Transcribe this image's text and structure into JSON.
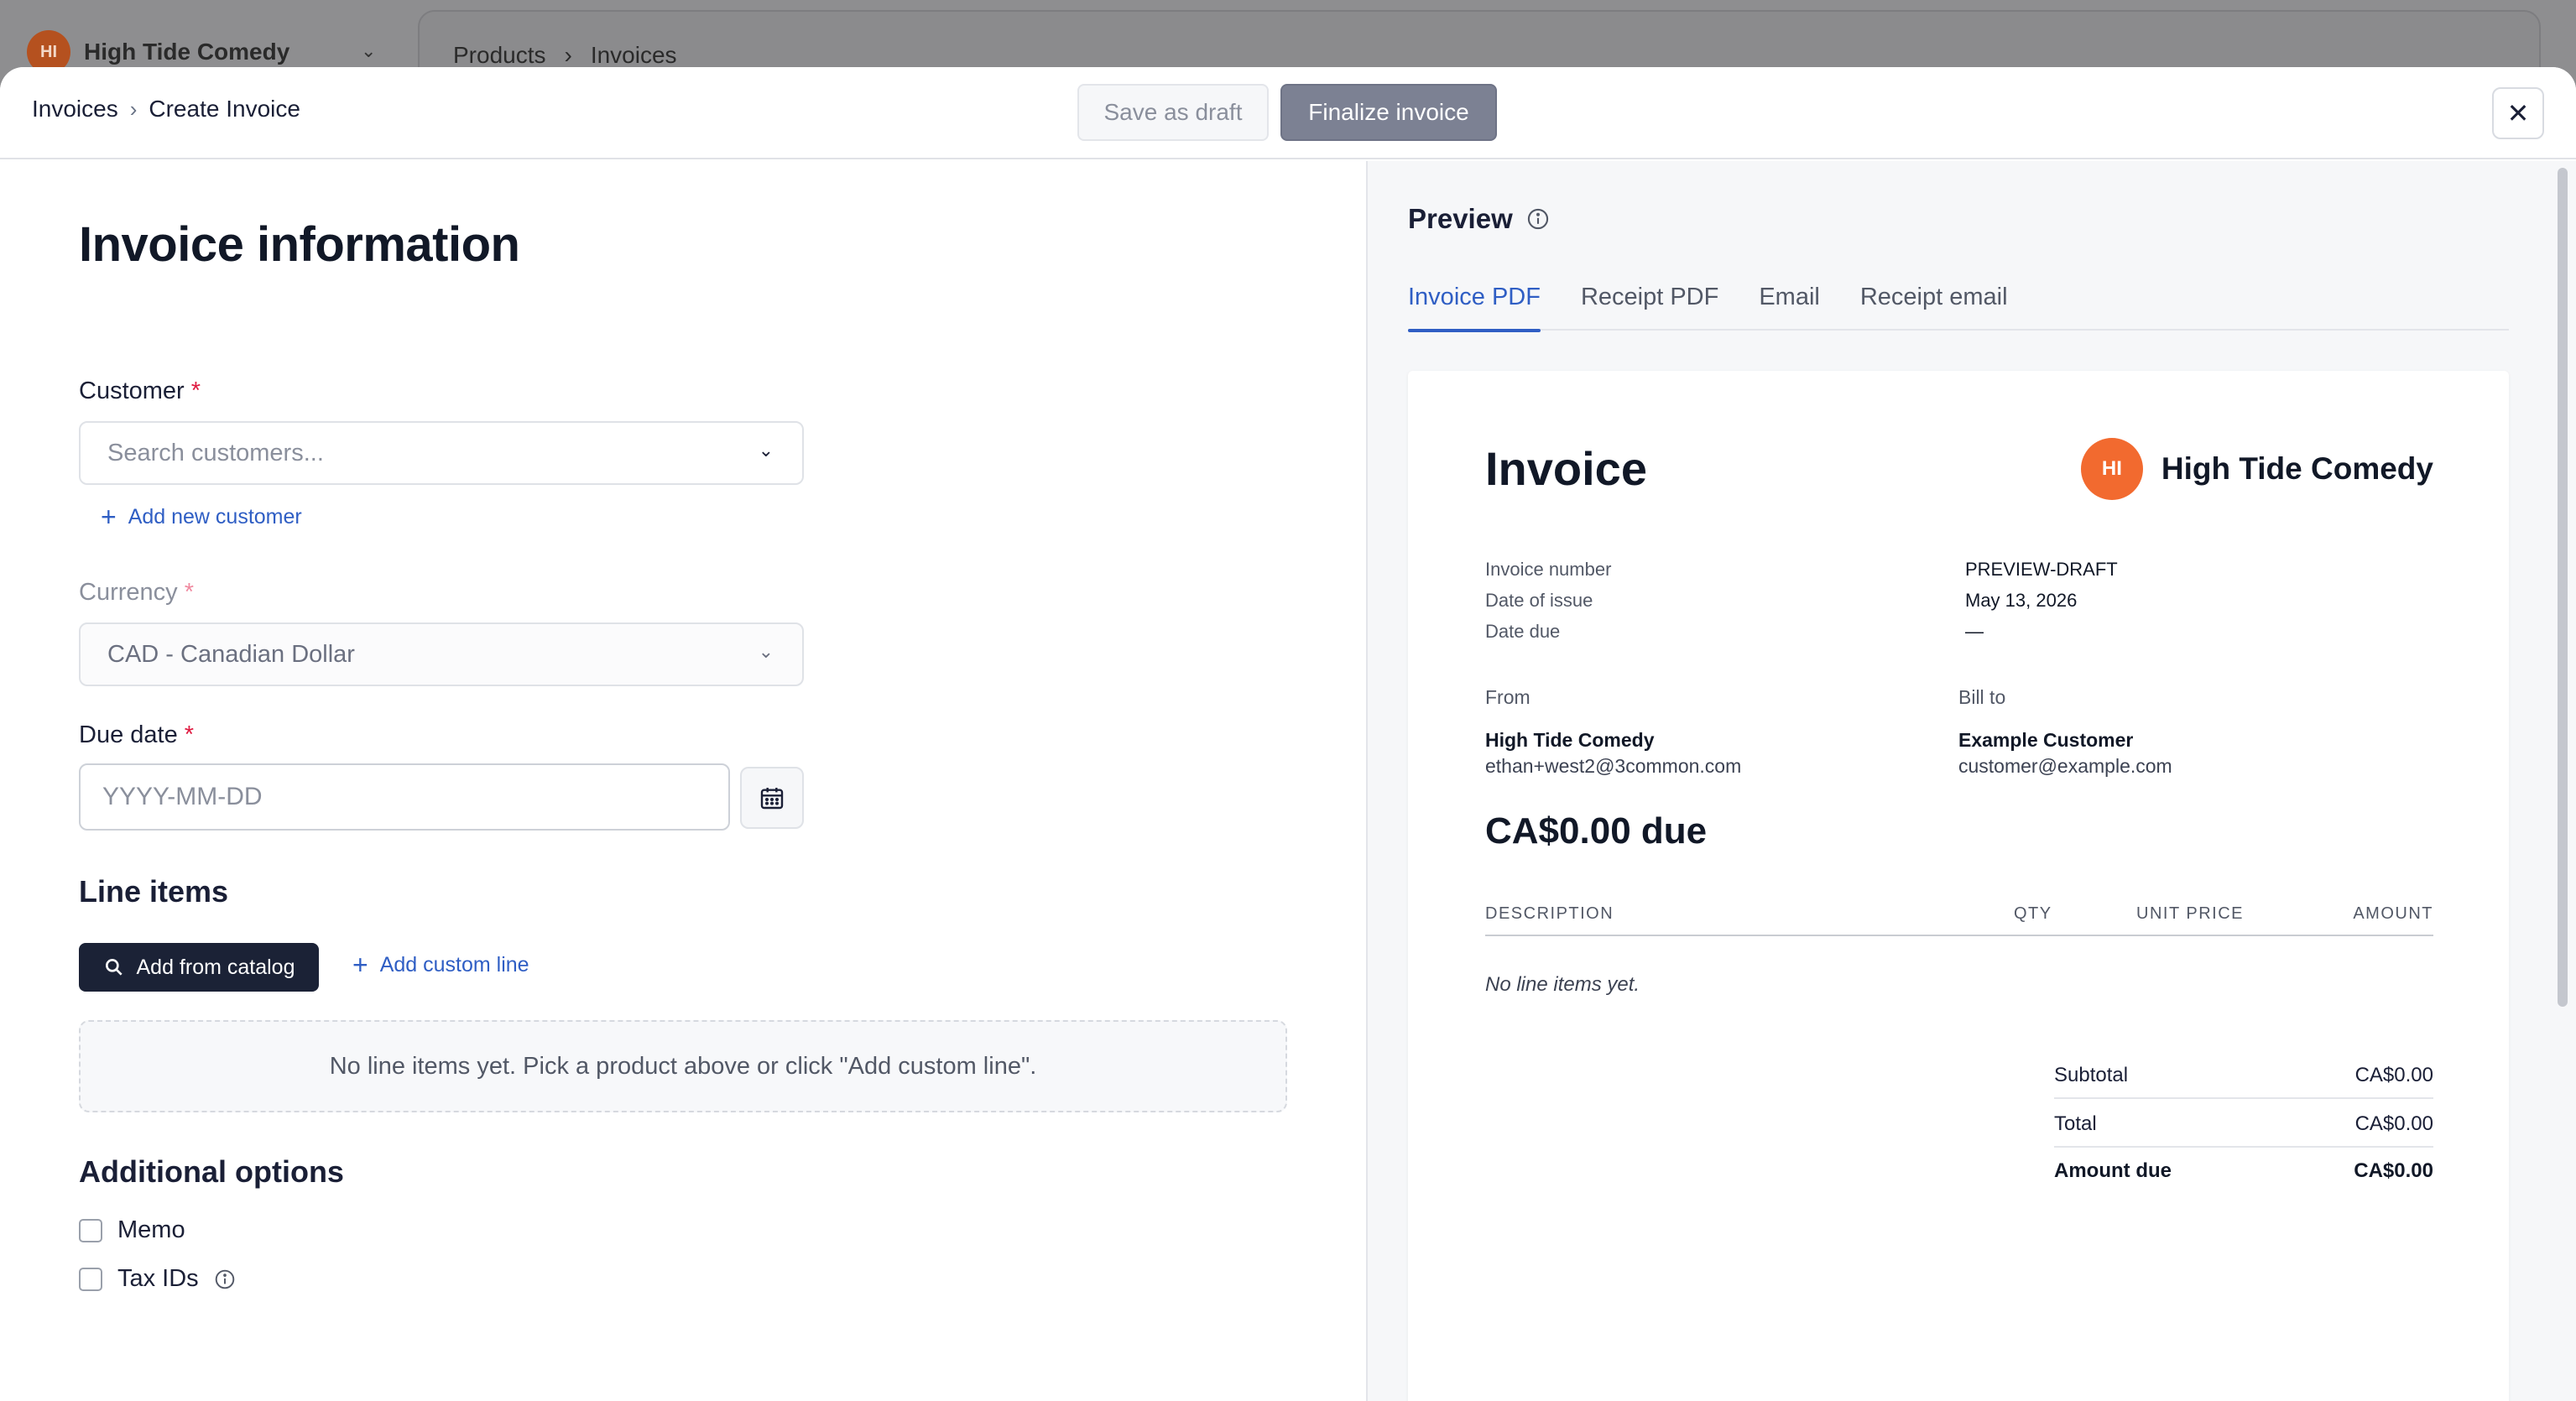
{
  "background": {
    "brand_initials": "HI",
    "brand_name": "High Tide Comedy",
    "breadcrumb": [
      "Products",
      "Invoices"
    ]
  },
  "topbar": {
    "breadcrumb_parent": "Invoices",
    "breadcrumb_current": "Create Invoice",
    "save_draft_label": "Save as draft",
    "finalize_label": "Finalize invoice",
    "close_icon": "close-icon"
  },
  "form": {
    "title": "Invoice information",
    "customer_label": "Customer",
    "required_mark": "*",
    "customer_placeholder": "Search customers...",
    "add_customer_label": "Add new customer",
    "currency_label": "Currency",
    "currency_value": "CAD - Canadian Dollar",
    "due_date_label": "Due date",
    "due_date_placeholder": "YYYY-MM-DD",
    "line_items_heading": "Line items",
    "add_catalog_label": "Add from catalog",
    "add_custom_line_label": "Add custom line",
    "empty_line_items": "No line items yet. Pick a product above or click \"Add custom line\".",
    "additional_options_heading": "Additional options",
    "memo_label": "Memo",
    "tax_ids_label": "Tax IDs"
  },
  "preview": {
    "title": "Preview",
    "tabs": [
      {
        "label": "Invoice PDF",
        "active": true
      },
      {
        "label": "Receipt PDF",
        "active": false
      },
      {
        "label": "Email",
        "active": false
      },
      {
        "label": "Receipt email",
        "active": false
      }
    ],
    "invoice": {
      "title": "Invoice",
      "logo_initials": "HI",
      "brand_name": "High Tide Comedy",
      "invoice_number_label": "Invoice number",
      "invoice_number": "PREVIEW-DRAFT",
      "date_of_issue_label": "Date of issue",
      "date_of_issue": "May 13, 2026",
      "date_due_label": "Date due",
      "date_due": "—",
      "from_label": "From",
      "from_name": "High Tide Comedy",
      "from_email": "ethan+west2@3common.com",
      "bill_to_label": "Bill to",
      "bill_to_name": "Example Customer",
      "bill_to_email": "customer@example.com",
      "amount_due_headline": "CA$0.00 due",
      "columns": [
        "DESCRIPTION",
        "QTY",
        "UNIT PRICE",
        "AMOUNT"
      ],
      "empty_items": "No line items yet.",
      "subtotal_label": "Subtotal",
      "subtotal": "CA$0.00",
      "total_label": "Total",
      "total": "CA$0.00",
      "amount_due_label": "Amount due",
      "amount_due": "CA$0.00"
    }
  },
  "colors": {
    "accent": "#2f5ec4",
    "required": "#df1b41",
    "brand_orange": "#f26a2f",
    "dark_button": "#1b2236"
  }
}
